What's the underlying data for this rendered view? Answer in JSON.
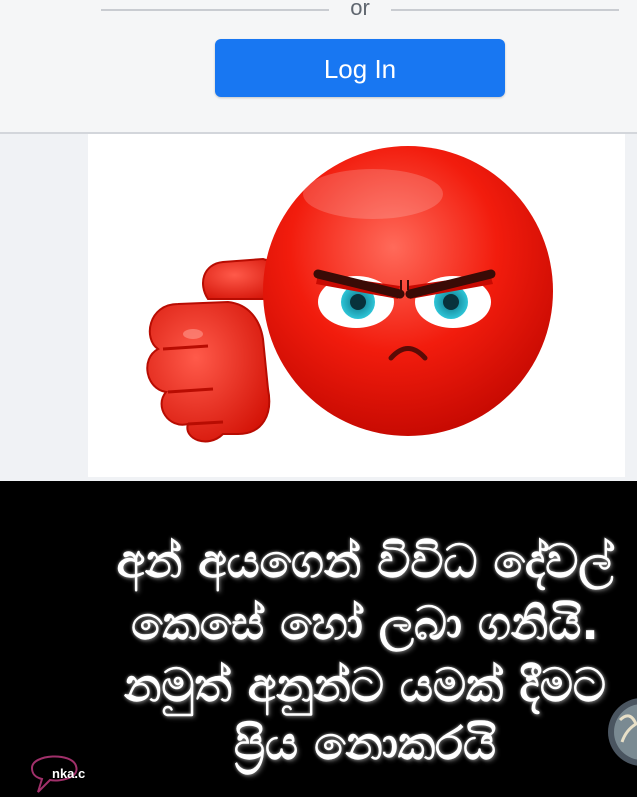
{
  "login": {
    "divider_text": "or",
    "button_label": "Log In"
  },
  "post": {
    "image_alt": "angry red emoji with thumbs down",
    "quote_lines": [
      "අන් අයගෙන් විවිධ දේවල්",
      "කෙසේ හෝ ලබා ගනියි.",
      "නමුත් අනුන්ට යමක් දීමට",
      "ප්‍රිය නොකරයි"
    ],
    "watermark": "nka.c"
  },
  "colors": {
    "brand_blue": "#1877f2",
    "emoji_red": "#f21c0d"
  }
}
